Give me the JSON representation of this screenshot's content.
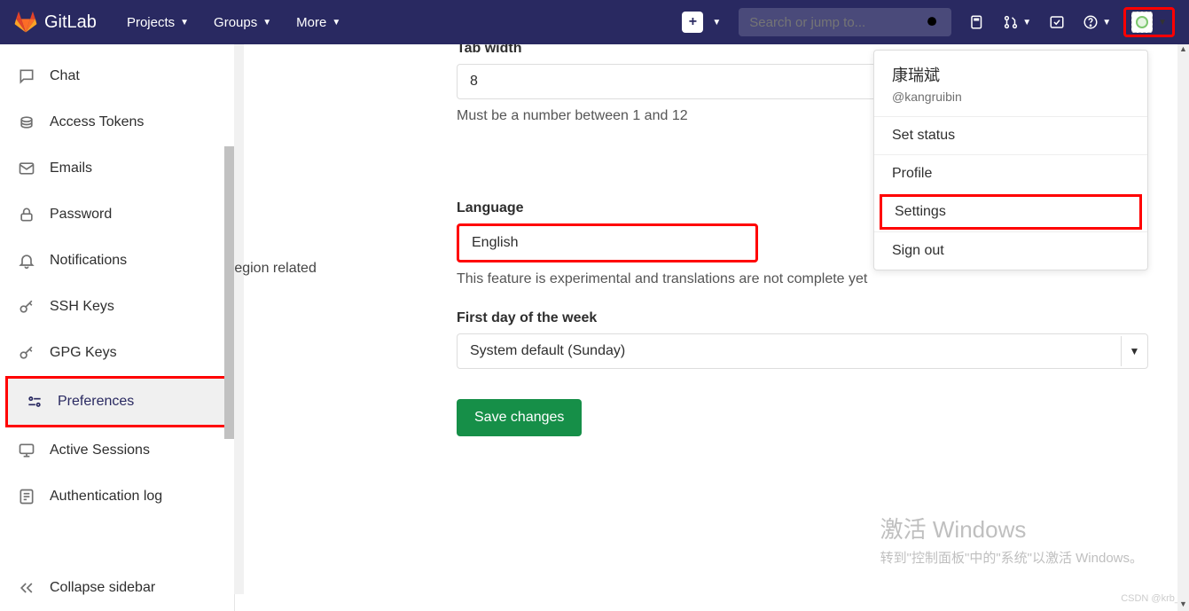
{
  "app": {
    "name": "GitLab"
  },
  "nav": {
    "projects": "Projects",
    "groups": "Groups",
    "more": "More"
  },
  "search": {
    "placeholder": "Search or jump to..."
  },
  "sidebar": {
    "items": [
      {
        "label": "Chat"
      },
      {
        "label": "Access Tokens"
      },
      {
        "label": "Emails"
      },
      {
        "label": "Password"
      },
      {
        "label": "Notifications"
      },
      {
        "label": "SSH Keys"
      },
      {
        "label": "GPG Keys"
      },
      {
        "label": "Preferences"
      },
      {
        "label": "Active Sessions"
      },
      {
        "label": "Authentication log"
      }
    ],
    "collapse": "Collapse sidebar"
  },
  "section_label": "region related",
  "tab_width": {
    "label": "Tab width",
    "value": "8",
    "hint": "Must be a number between 1 and 12"
  },
  "language": {
    "label": "Language",
    "value": "English",
    "hint": "This feature is experimental and translations are not complete yet"
  },
  "first_day": {
    "label": "First day of the week",
    "value": "System default (Sunday)"
  },
  "save": "Save changes",
  "user_menu": {
    "name": "康瑞斌",
    "handle": "@kangruibin",
    "set_status": "Set status",
    "profile": "Profile",
    "settings": "Settings",
    "sign_out": "Sign out"
  },
  "watermark": {
    "title": "激活 Windows",
    "sub": "转到\"控制面板\"中的\"系统\"以激活 Windows。"
  },
  "csdn": "CSDN @krb_"
}
